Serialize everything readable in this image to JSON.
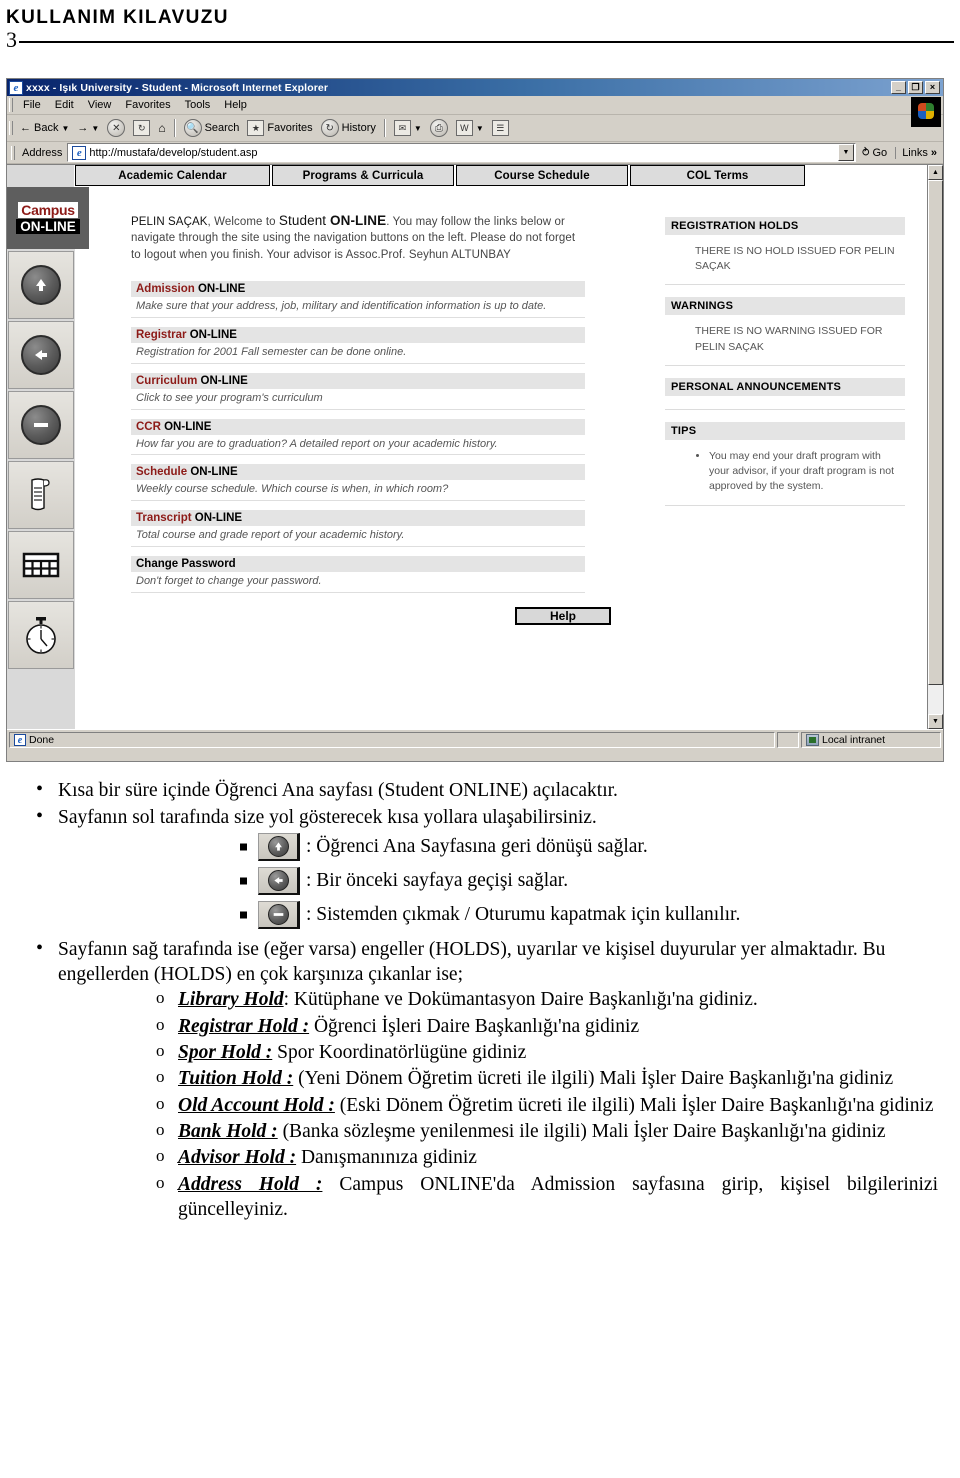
{
  "document": {
    "header_title": "KULLANIM KILAVUZU",
    "page_number": "3"
  },
  "browser": {
    "title": "xxxx - Işık University - Student - Microsoft Internet Explorer",
    "window_buttons": {
      "minimize": "_",
      "restore": "❐",
      "close": "×"
    },
    "menu": [
      "File",
      "Edit",
      "View",
      "Favorites",
      "Tools",
      "Help"
    ],
    "toolbar": {
      "back": "Back",
      "forward": "",
      "stop": "✕",
      "refresh": "↻",
      "home": "⌂",
      "search": "Search",
      "favorites": "Favorites",
      "history": "History",
      "mail": "✉",
      "print": "⎙",
      "edit": "W",
      "discuss": "☰"
    },
    "address": {
      "label": "Address",
      "url": "http://mustafa/develop/student.asp",
      "go": "Go",
      "links": "Links"
    },
    "status": {
      "text": "Done",
      "zone": "Local intranet"
    }
  },
  "page": {
    "tabs": [
      "Academic Calendar",
      "Programs & Curricula",
      "Course Schedule",
      "COL Terms"
    ],
    "logo": {
      "top": "Campus",
      "bottom": "ON-LINE"
    },
    "nav_buttons": [
      {
        "name": "home-up-button",
        "icon": "arrow-up-icon"
      },
      {
        "name": "back-button",
        "icon": "arrow-left-icon"
      },
      {
        "name": "logout-button",
        "icon": "minus-icon"
      },
      {
        "name": "transcript-button",
        "icon": "scroll-document-icon"
      },
      {
        "name": "schedule-button",
        "icon": "grid-table-icon"
      },
      {
        "name": "clock-button",
        "icon": "stopwatch-icon"
      }
    ],
    "welcome": {
      "student_name": "PELIN SAÇAK",
      "part1": ", Welcome to ",
      "student_word": "Student ",
      "online_word": "ON-LINE",
      "part2": ". You may follow the links below or navigate through the site using the navigation buttons on the left. Please do not forget to logout when you finish. Your advisor is Assoc.Prof. Seyhun ALTUNBAY"
    },
    "links": [
      {
        "head_red": "Admission",
        "head_rest": " ON-LINE",
        "body": "Make sure that your address, job, military and identification information is up to date."
      },
      {
        "head_red": "Registrar",
        "head_rest": " ON-LINE",
        "body": "Registration for 2001 Fall semester can be done online."
      },
      {
        "head_red": "Curriculum",
        "head_rest": " ON-LINE",
        "body": "Click to see your program's curriculum"
      },
      {
        "head_red": "CCR",
        "head_rest": " ON-LINE",
        "body": "How far you are to graduation? A detailed report on your academic history."
      },
      {
        "head_red": "Schedule",
        "head_rest": " ON-LINE",
        "body": "Weekly course schedule. Which course is when, in which room?"
      },
      {
        "head_red": "Transcript",
        "head_rest": " ON-LINE",
        "body": "Total course and grade report of your academic history."
      },
      {
        "head_red": "",
        "head_rest": "Change Password",
        "body": "Don't forget to change your password."
      }
    ],
    "help_button": "Help",
    "panels": [
      {
        "title": "REGISTRATION HOLDS",
        "body": "THERE IS NO HOLD ISSUED FOR PELIN SAÇAK",
        "type": "text"
      },
      {
        "title": "WARNINGS",
        "body": "THERE IS NO WARNING ISSUED FOR PELIN SAÇAK",
        "type": "text"
      },
      {
        "title": "PERSONAL ANNOUNCEMENTS",
        "body": "",
        "type": "empty"
      },
      {
        "title": "TIPS",
        "body": "You may end your draft program with your advisor, if your draft program is not approved by the system.",
        "type": "bullet"
      }
    ]
  },
  "body_text": {
    "bullets": [
      "Kısa bir süre içinde Öğrenci Ana sayfası (Student ONLINE) açılacaktır.",
      "Sayfanın sol tarafında size yol gösterecek kısa yollara ulaşabilirsiniz."
    ],
    "button_items": [
      {
        "icon": "arrow-up-icon",
        "text": ": Öğrenci Ana Sayfasına geri dönüşü sağlar."
      },
      {
        "icon": "arrow-left-icon",
        "text": ": Bir önceki sayfaya geçişi sağlar."
      },
      {
        "icon": "minus-icon",
        "text": ": Sistemden  çıkmak / Oturumu kapatmak için kullanılır."
      }
    ],
    "holds_intro": "Sayfanın sağ tarafında ise (eğer varsa) engeller (HOLDS), uyarılar ve kişisel duyurular yer almaktadır. Bu engellerden (HOLDS) en çok karşınıza çıkanlar ise;",
    "holds": [
      {
        "label": "Library Hold",
        "sep": ": ",
        "text": "Kütüphane ve Dokümantasyon Daire Başkanlığı'na gidiniz.",
        "justify": false
      },
      {
        "label": "Registrar Hold :",
        "sep": " ",
        "text": "Öğrenci İşleri Daire Başkanlığı'na gidiniz",
        "justify": false
      },
      {
        "label": "Spor Hold :",
        "sep": " ",
        "text": "Spor Koordinatörlügüne gidiniz",
        "justify": false
      },
      {
        "label": "Tuition  Hold  :",
        "sep": " ",
        "text": "(Yeni Dönem Öğretim ücreti ile ilgili) Mali İşler Daire Başkanlığı'na gidiniz",
        "justify": true
      },
      {
        "label": "Old Account Hold :",
        "sep": " ",
        "text": "(Eski Dönem Öğretim ücreti ile ilgili) Mali İşler Daire Başkanlığı'na gidiniz",
        "justify": true
      },
      {
        "label": "Bank  Hold  :",
        "sep": " ",
        "text": "(Banka sözleşme yenilenmesi ile ilgili) Mali İşler Daire Başkanlığı'na gidiniz",
        "justify": true
      },
      {
        "label": "Advisor Hold :",
        "sep": " ",
        "text": "Danışmanınıza gidiniz",
        "justify": false
      },
      {
        "label": "Address  Hold  :",
        "sep": " ",
        "text": "Campus ONLINE'da Admission sayfasına girip, kişisel bilgilerinizi güncelleyiniz.",
        "justify": true
      }
    ]
  }
}
